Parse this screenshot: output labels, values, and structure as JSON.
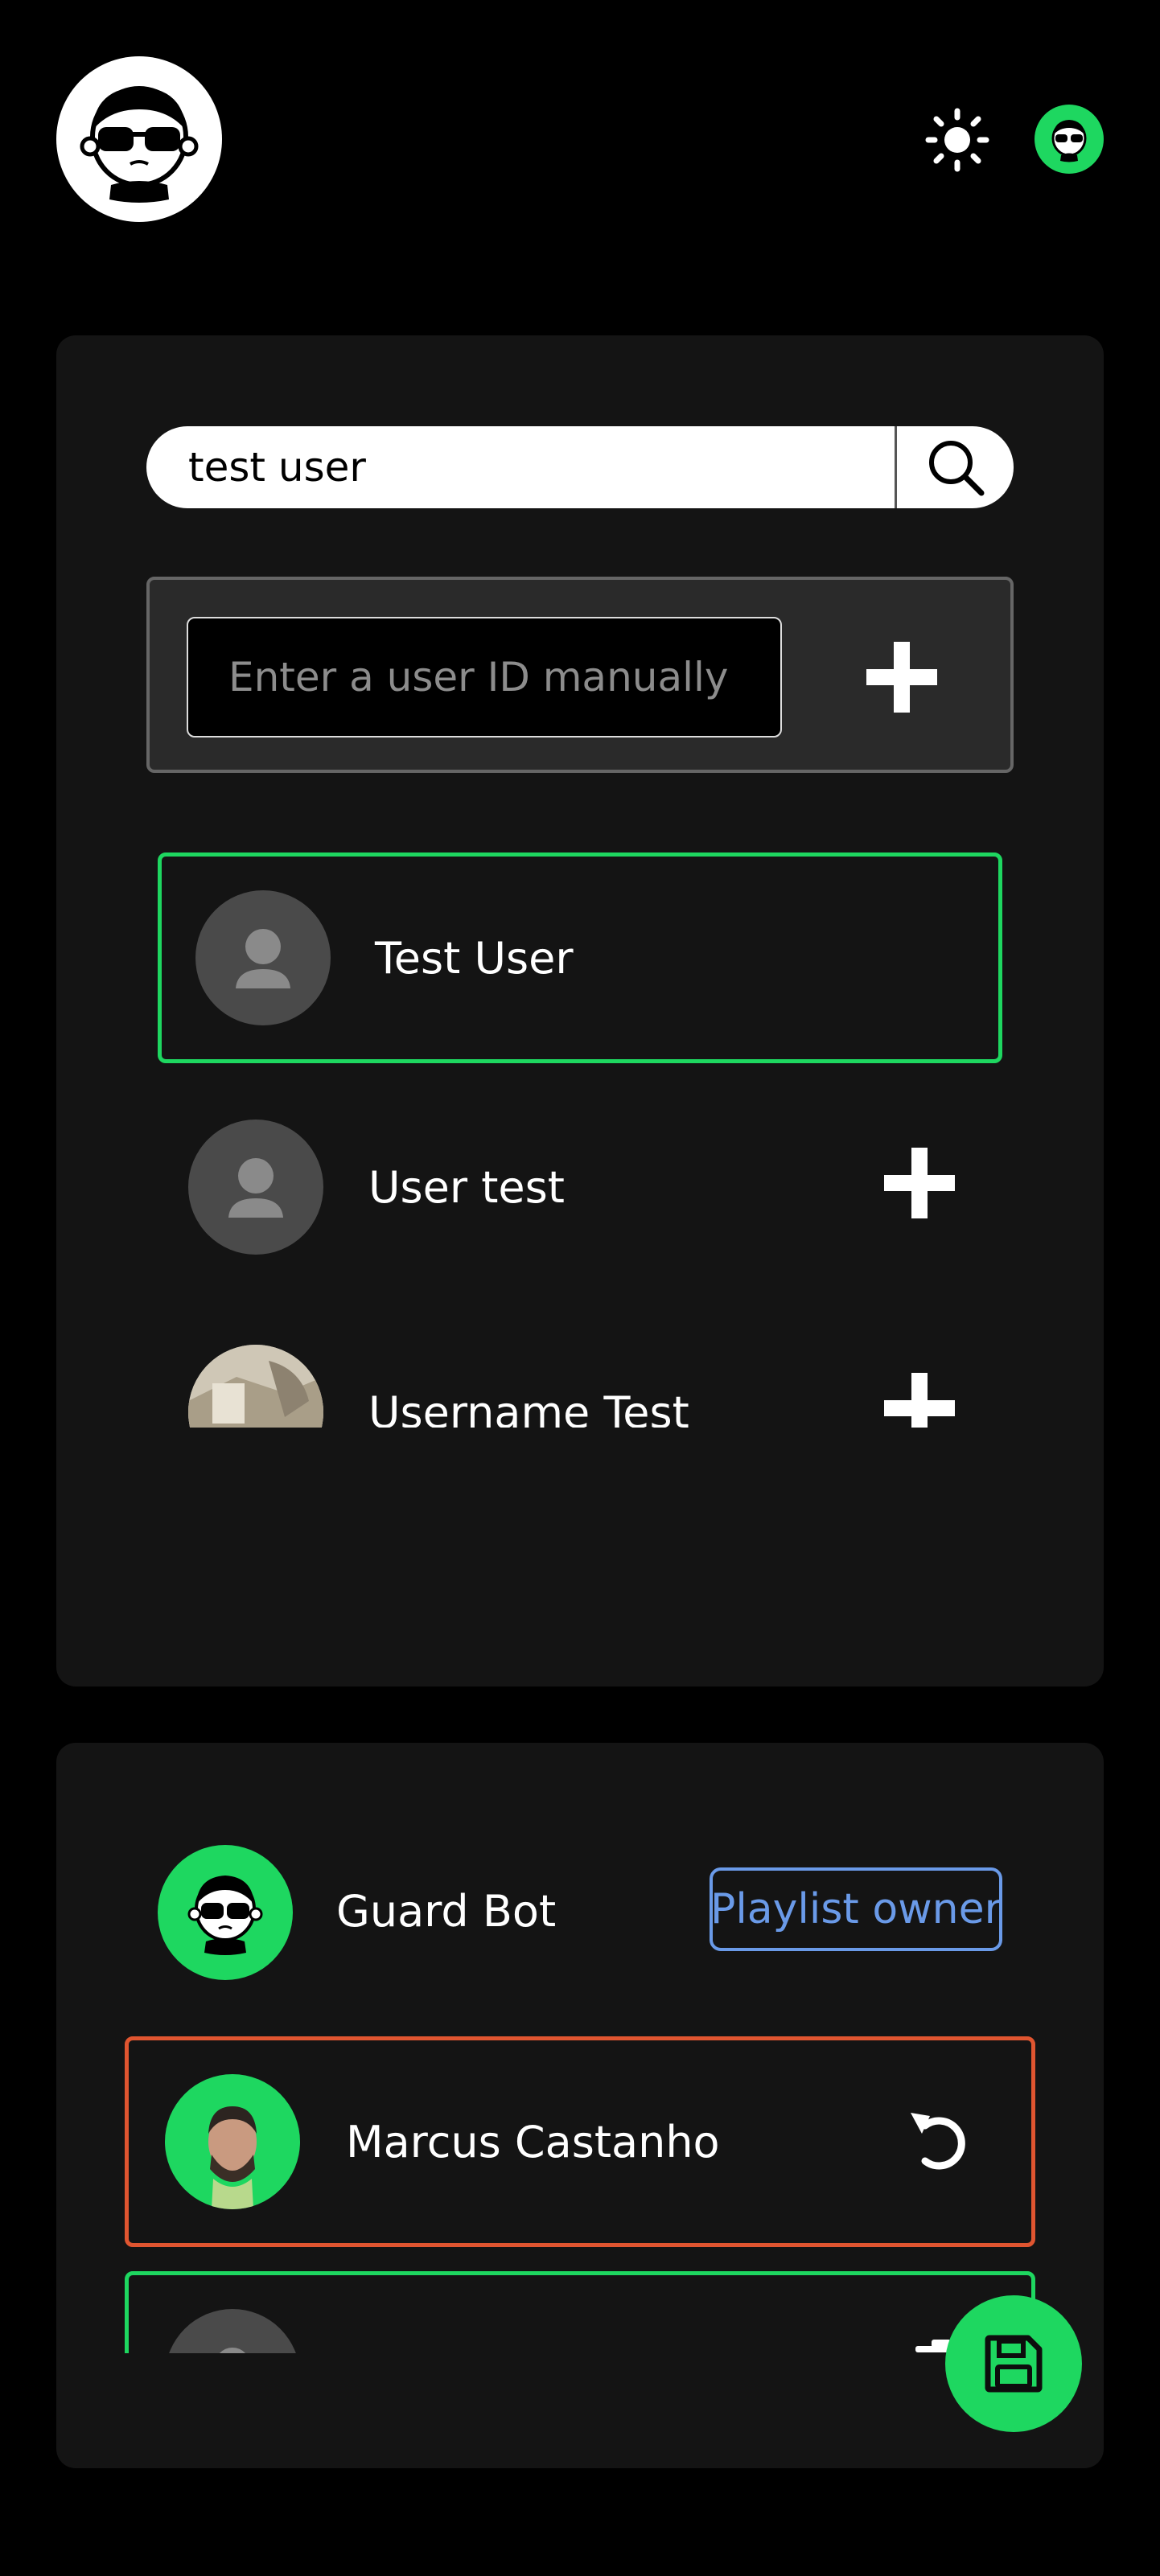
{
  "header": {
    "logo_icon": "guard-bot-logo",
    "theme_icon": "sun-icon",
    "profile_icon": "guard-bot-avatar"
  },
  "search": {
    "value": "test user",
    "button_icon": "search-icon"
  },
  "manual_entry": {
    "placeholder": "Enter a user ID manually",
    "add_icon": "plus-icon"
  },
  "results": [
    {
      "name": "Test User",
      "selected": true
    },
    {
      "name": "User test",
      "selected": false
    },
    {
      "name": "Username Test",
      "selected": false
    }
  ],
  "members": {
    "owner": {
      "name": "Guard Bot",
      "badge": "Playlist owner"
    },
    "pending_removal": {
      "name": "Marcus Castanho",
      "action_icon": "undo-icon"
    },
    "pending_add": {
      "action_icon": "remove-icon"
    }
  },
  "save_button_icon": "save-icon",
  "colors": {
    "accent": "#1ed760",
    "removal": "#e05530",
    "owner_badge": "#6a9ae8",
    "panel": "#141414",
    "background": "#000000"
  }
}
